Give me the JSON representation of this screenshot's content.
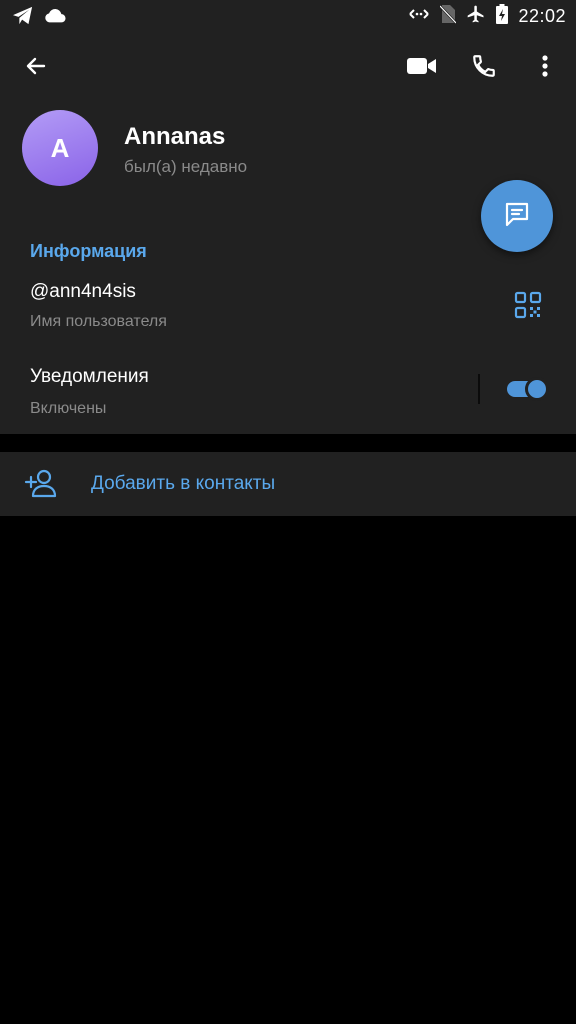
{
  "status_bar": {
    "time": "22:02",
    "left_icons": [
      "telegram-icon",
      "cloud-icon"
    ],
    "right_icons": [
      "data-arrows-icon",
      "no-sim-icon",
      "airplane-icon",
      "battery-charging-icon"
    ]
  },
  "header": {
    "back_icon": "arrow-left-icon",
    "actions": [
      "video-camera-icon",
      "phone-icon",
      "more-vertical-icon"
    ]
  },
  "profile": {
    "avatar_letter": "A",
    "name": "Annanas",
    "status": "был(а) недавно"
  },
  "fab_icon": "message-icon",
  "info": {
    "title": "Информация",
    "username": "@ann4n4sis",
    "username_label": "Имя пользователя",
    "notifications_label": "Уведомления",
    "notifications_status": "Включены",
    "notifications_enabled": true
  },
  "add_contact": {
    "label": "Добавить в контакты"
  },
  "colors": {
    "accent": "#4f95d9",
    "accent_text": "#5aa8ec",
    "surface": "#212121",
    "background": "#000000",
    "secondary_text": "#8a8a8a"
  }
}
